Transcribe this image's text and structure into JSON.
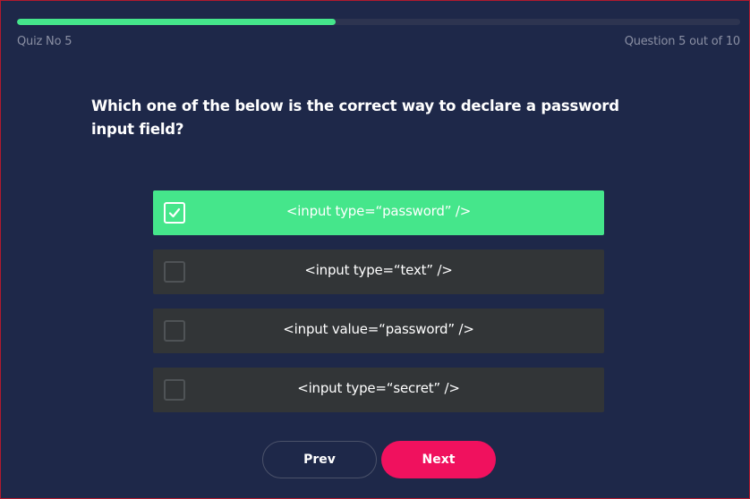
{
  "header": {
    "quiz_label": "Quiz No 5",
    "question_counter": "Question 5 out of 10",
    "progress_fraction": 0.44
  },
  "question": {
    "text": "Which one of the below is the correct way to declare a password input field?"
  },
  "options": [
    {
      "label": "<input type=“password” />",
      "selected": true
    },
    {
      "label": "<input type=“text” />",
      "selected": false
    },
    {
      "label": "<input value=“password” />",
      "selected": false
    },
    {
      "label": "<input type=“secret” />",
      "selected": false
    }
  ],
  "navigation": {
    "prev_label": "Prev",
    "next_label": "Next"
  },
  "colors": {
    "background": "#1e2849",
    "accent_green": "#45e68b",
    "option_bg": "#323537",
    "next_pink": "#f0115e",
    "muted_text": "#8a8fa3"
  },
  "icons": {
    "selected_option": "checkmark-icon"
  }
}
